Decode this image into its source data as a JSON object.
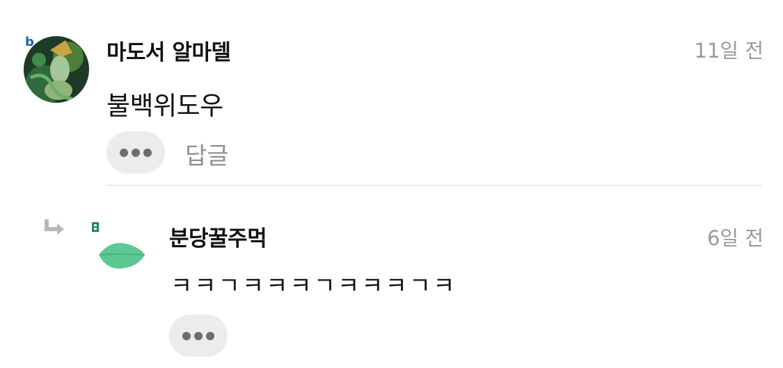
{
  "comments": [
    {
      "author": "마도서 알마델",
      "time": "11일 전",
      "text": "불백위도우",
      "reply_label": "답글",
      "avatar_icon": "character-avatar",
      "badge_icon": "b-badge-icon",
      "badge_color": "#1f5fa8"
    },
    {
      "author": "분당꿀주먹",
      "time": "6일 전",
      "text": "ㅋㅋㄱㅋㅋㅋㄱㅋㅋㅋㄱㅋ",
      "avatar_icon": "leaf-icon",
      "leaf_color": "#5cc894",
      "reply_arrow_icon": "reply-arrow-icon"
    }
  ]
}
